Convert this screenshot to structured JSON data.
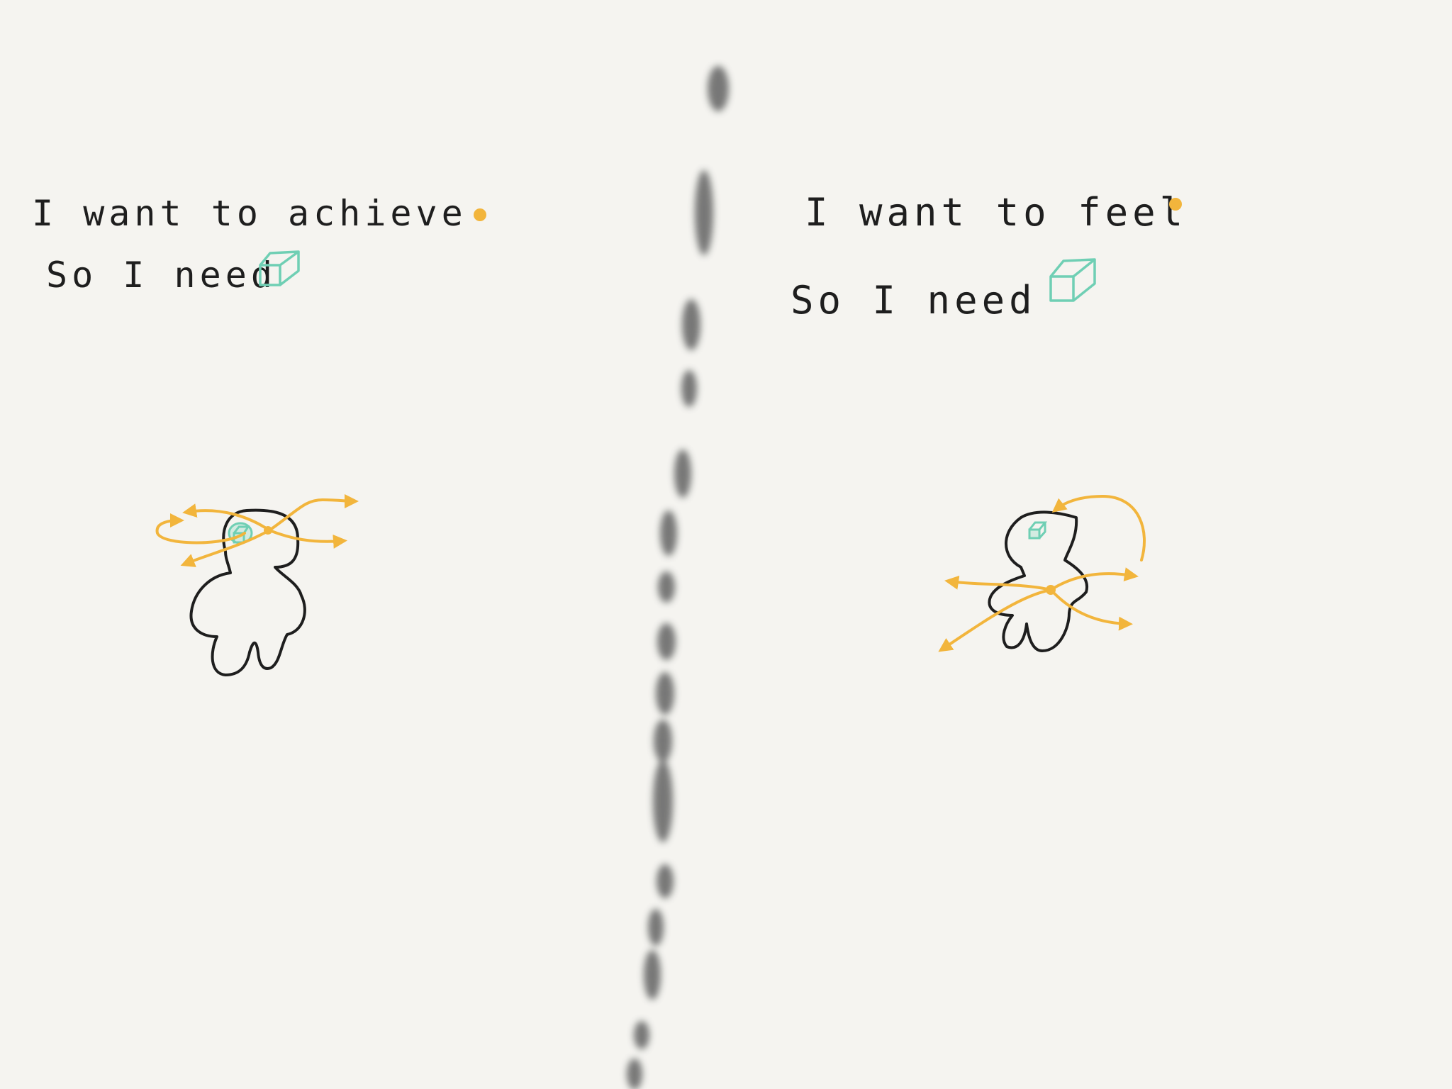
{
  "left_panel": {
    "line1": "I want to achieve",
    "line2": "So I need"
  },
  "right_panel": {
    "line1": "I want to feel",
    "line2": "So I need"
  },
  "colors": {
    "background": "#f5f4f0",
    "ink": "#1e1e1e",
    "accent_orange": "#f2b53c",
    "accent_teal": "#6fcfb4",
    "divider": "#6b6b6b"
  },
  "icons": {
    "goal_marker": "orange-dot",
    "need_marker": "teal-cube",
    "figure": "person-outline",
    "arrows": "orange-arrows"
  }
}
